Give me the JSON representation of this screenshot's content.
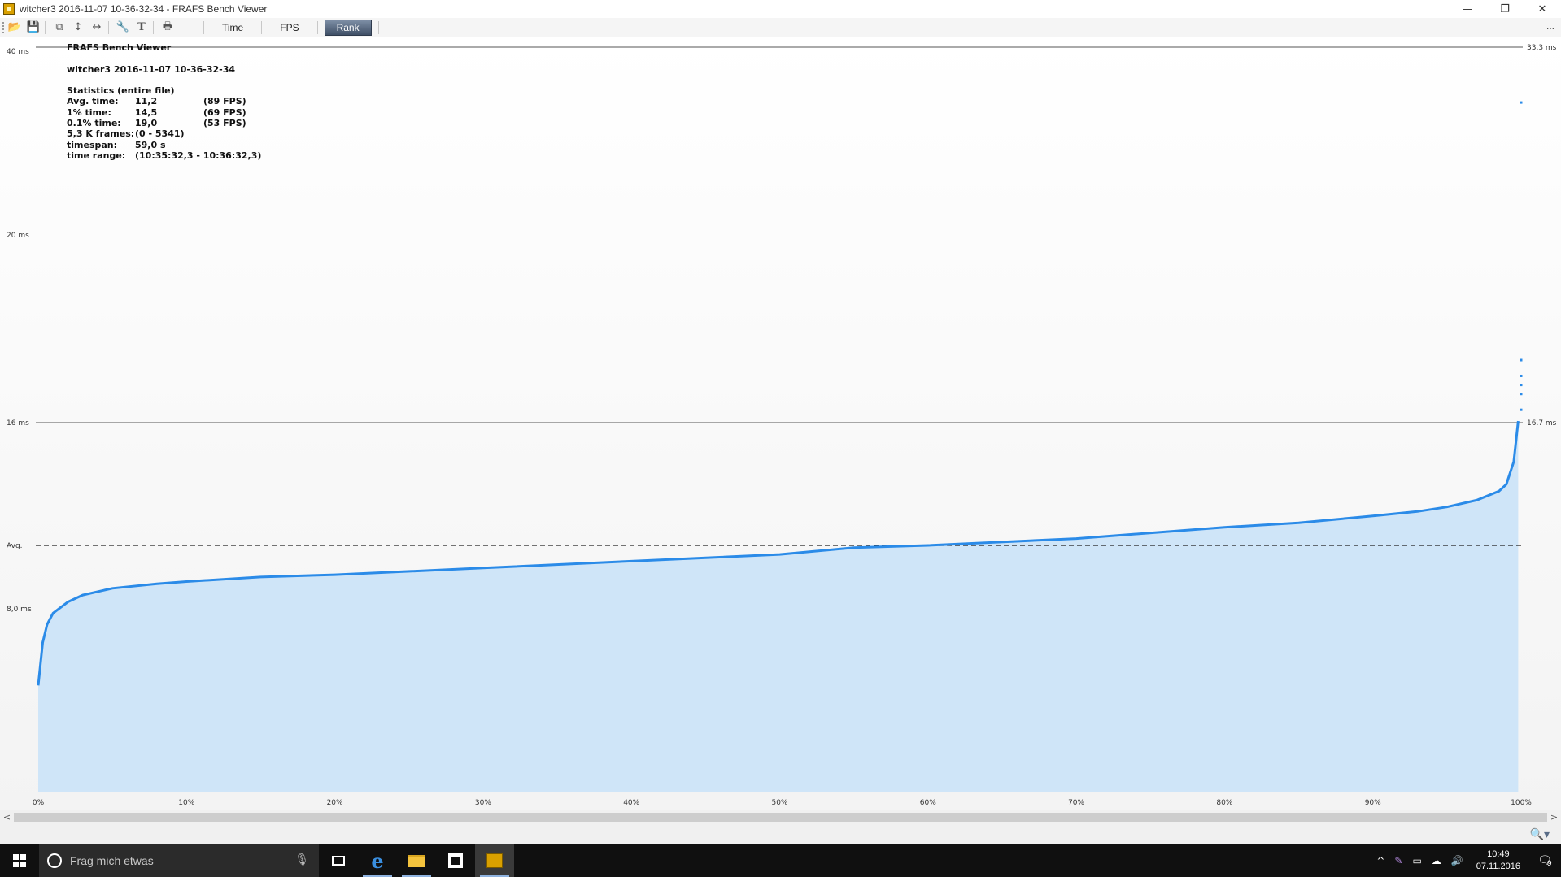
{
  "window": {
    "title": "witcher3 2016-11-07 10-36-32-34 - FRAFS Bench Viewer",
    "minimize_glyph": "—",
    "restore_glyph": "❐",
    "close_glyph": "✕"
  },
  "toolbar": {
    "icons": [
      "open-folder-icon",
      "save-icon",
      "copy-icon",
      "fit-vertical-icon",
      "fit-horizontal-icon",
      "wrench-icon",
      "text-icon",
      "print-icon"
    ],
    "buttons": [
      {
        "label": "Time",
        "active": false
      },
      {
        "label": "FPS",
        "active": false
      },
      {
        "label": "Rank",
        "active": true
      }
    ],
    "overflow": "..."
  },
  "stats": {
    "app_name": "FRAFS Bench Viewer",
    "file_name": "witcher3 2016-11-07 10-36-32-34",
    "section_title": "Statistics (entire file)",
    "rows": [
      {
        "label": "Avg. time:",
        "value": "11,2",
        "extra": "(89 FPS)"
      },
      {
        "label": "1% time:",
        "value": "14,5",
        "extra": "(69 FPS)"
      },
      {
        "label": "0.1% time:",
        "value": "19,0",
        "extra": "(53 FPS)"
      },
      {
        "label": "5,3 K frames:",
        "value": "(0 - 5341)",
        "extra": ""
      },
      {
        "label": "timespan:",
        "value": "59,0 s",
        "extra": ""
      },
      {
        "label": "time range:",
        "value": "(10:35:32,3 - 10:36:32,3)",
        "extra": ""
      }
    ]
  },
  "chart_data": {
    "type": "area",
    "title": "",
    "xlabel": "",
    "ylabel": "",
    "x_unit": "%",
    "y_unit": "ms",
    "x_ticks": [
      "0%",
      "10%",
      "20%",
      "30%",
      "40%",
      "50%",
      "60%",
      "70%",
      "80%",
      "90%",
      "100%"
    ],
    "y_tick_labels": [
      {
        "label": "40 ms"
      },
      {
        "label": "20 ms"
      },
      {
        "label": "16 ms"
      },
      {
        "label": "Avg."
      },
      {
        "label": "8,0 ms"
      }
    ],
    "reference_lines": [
      {
        "label": "33.3 ms",
        "style": "solid"
      },
      {
        "label": "16.7 ms",
        "style": "solid"
      },
      {
        "label": "Avg.",
        "style": "dashed"
      }
    ],
    "series": [
      {
        "x": [
          0,
          0.3,
          0.6,
          1,
          2,
          3,
          5,
          8,
          10,
          15,
          20,
          30,
          40,
          50,
          55,
          60,
          70,
          80,
          85,
          90,
          93,
          95,
          97,
          98.5,
          99,
          99.5,
          99.8,
          100
        ],
        "y": [
          4.7,
          6.6,
          7.4,
          7.9,
          8.4,
          8.7,
          9.0,
          9.2,
          9.3,
          9.5,
          9.6,
          9.9,
          10.2,
          10.5,
          10.8,
          10.9,
          11.2,
          11.7,
          11.9,
          12.2,
          12.4,
          12.6,
          12.9,
          13.3,
          13.6,
          14.6,
          16.4,
          33.5
        ]
      }
    ],
    "colors": {
      "line": "#2b8be8",
      "fill": "#cfe5f8",
      "dashed": "#222222"
    },
    "grid": false
  },
  "scrollbar": {
    "left_arrow": "<",
    "right_arrow": ">"
  },
  "taskbar": {
    "search_placeholder": "Frag mich etwas",
    "mic_glyph": "🎙",
    "time": "10:49",
    "date": "07.11.2016",
    "notification_count": "9",
    "tray_icons": [
      "chevron-up-icon",
      "pen-icon",
      "network-icon",
      "onedrive-icon",
      "volume-icon"
    ],
    "tray_glyphs": [
      "^",
      "✎",
      "▭",
      "☁",
      "🔊"
    ]
  }
}
